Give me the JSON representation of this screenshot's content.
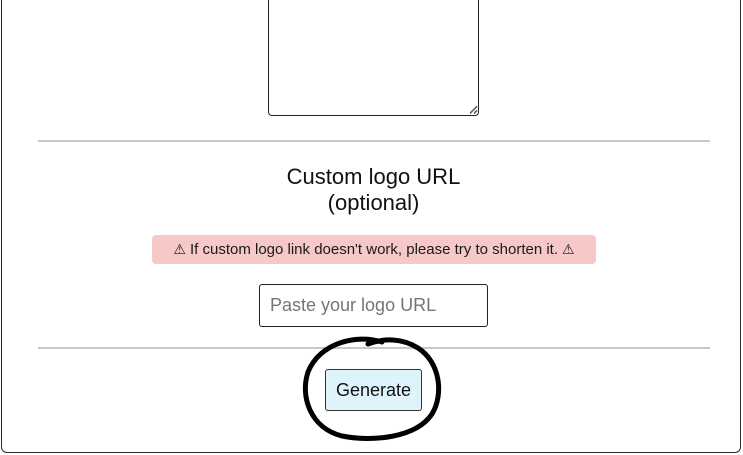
{
  "form": {
    "logo_section": {
      "heading_line1": "Custom logo URL",
      "heading_line2": "(optional)",
      "warning": {
        "text": "If custom logo link doesn't work, please try to shorten it.",
        "icon": "warning-triangle-icon",
        "icon_glyph": "⚠",
        "background_color": "#f7c8c8"
      },
      "input": {
        "value": "",
        "placeholder": "Paste your logo URL"
      }
    },
    "generate_button": {
      "label": "Generate",
      "background_color": "#dff3fd"
    }
  },
  "annotation": {
    "type": "hand-drawn-circle",
    "color": "#000000"
  }
}
